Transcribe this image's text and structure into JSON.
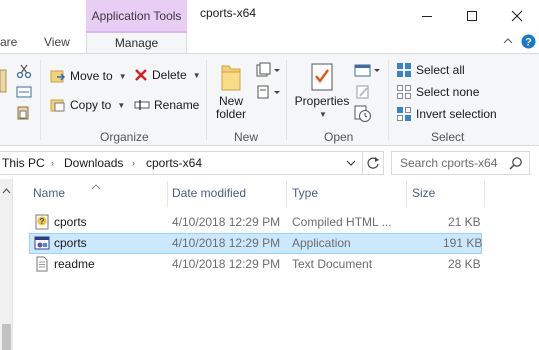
{
  "window": {
    "context_tab": "Application Tools",
    "title": "cports-x64"
  },
  "tabs": {
    "share": "are",
    "view": "View",
    "manage": "Manage"
  },
  "ribbon": {
    "move_to": "Move to",
    "copy_to": "Copy to",
    "delete": "Delete",
    "rename": "Rename",
    "organize": "Organize",
    "new_folder_l1": "New",
    "new_folder_l2": "folder",
    "new": "New",
    "properties": "Properties",
    "open": "Open",
    "select_all": "Select all",
    "select_none": "Select none",
    "invert_selection": "Invert selection",
    "select": "Select"
  },
  "address": {
    "crumbs": [
      "This PC",
      "Downloads",
      "cports-x64"
    ],
    "search_placeholder": "Search cports-x64"
  },
  "columns": {
    "name": "Name",
    "date": "Date modified",
    "type": "Type",
    "size": "Size"
  },
  "files": [
    {
      "name": "cports",
      "date": "4/10/2018 12:29 PM",
      "type": "Compiled HTML ...",
      "size": "21 KB",
      "icon": "help-file-icon"
    },
    {
      "name": "cports",
      "date": "4/10/2018 12:29 PM",
      "type": "Application",
      "size": "191 KB",
      "icon": "application-icon"
    },
    {
      "name": "readme",
      "date": "4/10/2018 12:29 PM",
      "type": "Text Document",
      "size": "28 KB",
      "icon": "text-file-icon"
    }
  ],
  "colors": {
    "selection": "#cce8ff",
    "context_tab": "#e8cdf5",
    "accent_blue": "#1979ca"
  }
}
